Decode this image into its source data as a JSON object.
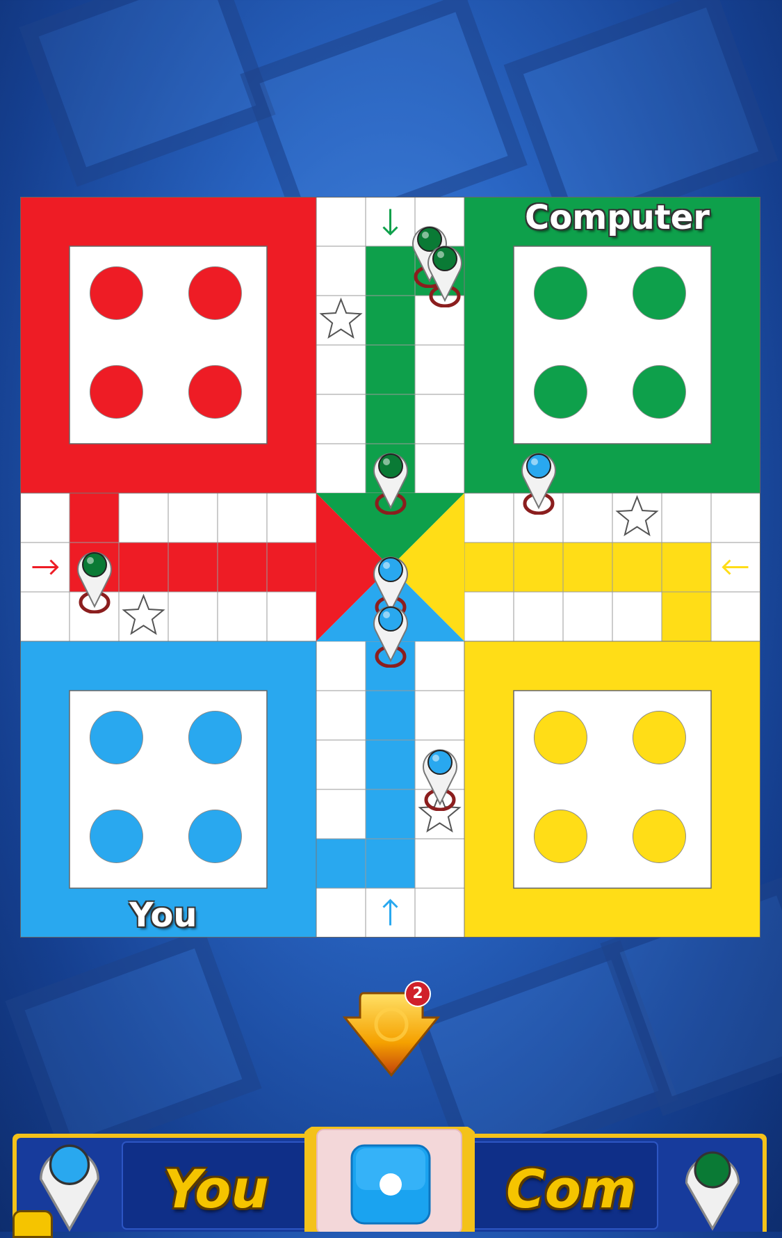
{
  "board": {
    "top_right_label": "Computer",
    "bottom_left_label": "You"
  },
  "colors": {
    "red": "#ee1c25",
    "green": "#0ea04b",
    "yellow": "#ffdd17",
    "blue": "#29a8ef"
  },
  "pieces": [
    {
      "color": "green",
      "location": "green home column"
    },
    {
      "color": "green",
      "location": "green home column"
    },
    {
      "color": "green",
      "location": "center finish"
    },
    {
      "color": "blue",
      "location": "right track"
    },
    {
      "color": "green",
      "location": "red home column"
    },
    {
      "color": "blue",
      "location": "center finish"
    },
    {
      "color": "blue",
      "location": "blue home column"
    },
    {
      "color": "blue",
      "location": "bottom track"
    }
  ],
  "dice_roll_button": {
    "icon": "dice-roll-arrow-icon",
    "badge_count": "2"
  },
  "bottom_bar": {
    "player_left": "You",
    "player_right": "Com",
    "player_left_color": "blue",
    "player_right_color": "green",
    "current_die_value": 1,
    "menu_icon": "list-menu-icon"
  }
}
